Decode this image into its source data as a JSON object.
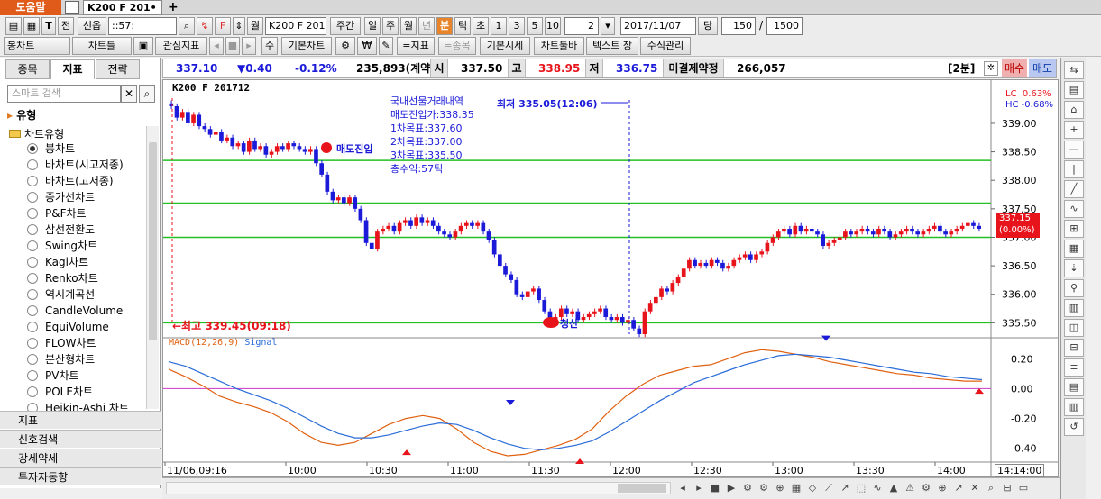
{
  "titlebar": {
    "help_label": "도움말",
    "tab_label": "K200 F 201•",
    "add_tab": "+"
  },
  "toolbar1": {
    "t_btn": "T",
    "front_btn": "전",
    "select_label": "선옵",
    "code_value": "::57:",
    "symbol_value": "K200 F 201",
    "period_btns": [
      "주간",
      "일",
      "주",
      "월",
      "년",
      "분",
      "틱",
      "초"
    ],
    "active_period": "분",
    "num_btns": [
      "1",
      "3",
      "5",
      "10"
    ],
    "interval_value": "2",
    "date_value": "2017/11/07",
    "dang": "당",
    "count_value": "150",
    "slash": "/",
    "total_value": "1500",
    "wol": "월"
  },
  "toolbar2": {
    "bong_chart": "봉차트",
    "chart_list": "차트틀",
    "watch_indicator": "관심지표",
    "su": "수",
    "basic_chart": "기본차트",
    "indicator": "=지표",
    "item": "=종목",
    "basic_price": "기본시세",
    "chart_toolbar": "차트툴바",
    "text_window": "텍스트 창",
    "formula_mgmt": "수식관리"
  },
  "leftpanel": {
    "tabs": [
      "종목",
      "지표",
      "전략"
    ],
    "active_tab": "지표",
    "search_placeholder": "스마트 검색",
    "root_label": "유형",
    "folder_label": "차트유형",
    "items": [
      "봉차트",
      "바차트(시고저종)",
      "바차트(고저종)",
      "종가선차트",
      "P&F차트",
      "삼선전환도",
      "Swing차트",
      "Kagi차트",
      "Renko차트",
      "역시계곡선",
      "CandleVolume",
      "EquiVolume",
      "FLOW차트",
      "분산형차트",
      "PV차트",
      "POLE차트",
      "Heikin-Ashi 차트"
    ],
    "selected_item": "봉차트",
    "sections": [
      "지표",
      "신호검색",
      "강세약세",
      "투자자동향"
    ]
  },
  "infobar": {
    "price": "337.10",
    "change": "▼0.40",
    "change_pct": "-0.12%",
    "volume": "235,893(계약)",
    "open_label": "시",
    "open": "337.50",
    "high_label": "고",
    "high": "338.95",
    "low_label": "저",
    "low": "336.75",
    "oi_label": "미결제약정",
    "oi": "266,057",
    "interval": "[2분]",
    "sell_label": "매수",
    "buy_label": "매도"
  },
  "chart": {
    "symbol_label": "K200 F 201712",
    "legend_lc": "LC  0.63%",
    "legend_hc": "HC -0.68%",
    "trade_info": [
      "국내선물거래내역",
      "매도진입가:338.35",
      "1차목표:337.60",
      "2차목표:337.00",
      "3차목표:335.50",
      "총수익:57틱"
    ],
    "low_annot": "최저 335.05(12:06)",
    "high_annot": "←최고 339.45(09:18)",
    "entry_label": "매도진입",
    "exit_label": "청산",
    "current_tag": "337.15",
    "current_tag_pct": "(0.00%)",
    "macd_label": "MACD(12,26,9)",
    "signal_label": "Signal",
    "bottom_time": "14:14:00",
    "colors": {
      "up": "#e8141c",
      "down": "#1a1ad8",
      "target_line": "#22c022",
      "macd": "#e06010",
      "signal": "#2a6cd8",
      "zero": "#c838c8"
    }
  },
  "chart_data": [
    {
      "type": "candlestick",
      "title": "K200 F 201712",
      "x_ticks": [
        "11/06,09:16",
        "10:00",
        "10:30",
        "11:00",
        "11:30",
        "12:00",
        "12:30",
        "13:00",
        "13:30",
        "14:00"
      ],
      "y_ticks": [
        "339.00",
        "338.50",
        "338.00",
        "337.50",
        "337.00",
        "336.50",
        "336.00",
        "335.50"
      ],
      "ylim": [
        335.3,
        339.6
      ],
      "horizontal_lines": [
        338.35,
        337.6,
        337.0,
        335.5
      ],
      "closes": [
        339.3,
        339.1,
        339.2,
        339.0,
        339.15,
        338.95,
        338.9,
        338.8,
        338.85,
        338.7,
        338.75,
        338.6,
        338.65,
        338.5,
        338.7,
        338.55,
        338.6,
        338.45,
        338.5,
        338.6,
        338.55,
        338.65,
        338.6,
        338.55,
        338.5,
        338.55,
        338.3,
        338.1,
        337.8,
        337.65,
        337.7,
        337.6,
        337.7,
        337.5,
        337.3,
        336.9,
        336.8,
        337.1,
        337.15,
        337.2,
        337.1,
        337.25,
        337.3,
        337.2,
        337.35,
        337.25,
        337.3,
        337.2,
        337.1,
        337.05,
        337.0,
        337.1,
        337.2,
        337.25,
        337.2,
        337.25,
        337.1,
        336.95,
        336.7,
        336.5,
        336.35,
        336.25,
        336.0,
        335.95,
        336.05,
        336.1,
        335.9,
        335.7,
        335.55,
        335.6,
        335.75,
        335.65,
        335.7,
        335.55,
        335.6,
        335.65,
        335.7,
        335.75,
        335.6,
        335.55,
        335.6,
        335.5,
        335.55,
        335.4,
        335.3,
        335.7,
        335.85,
        335.95,
        336.1,
        336.05,
        336.2,
        336.3,
        336.45,
        336.6,
        336.5,
        336.55,
        336.5,
        336.6,
        336.55,
        336.45,
        336.5,
        336.6,
        336.65,
        336.7,
        336.6,
        336.7,
        336.75,
        336.9,
        337.0,
        337.1,
        337.15,
        337.05,
        337.2,
        337.1,
        337.15,
        337.1,
        337.05,
        336.85,
        336.9,
        336.95,
        337.0,
        337.1,
        337.05,
        337.1,
        337.15,
        337.1,
        337.05,
        337.15,
        337.1,
        337.0,
        337.05,
        337.1,
        337.15,
        337.1,
        337.05,
        337.1,
        337.15,
        337.2,
        337.1,
        337.05,
        337.1,
        337.15,
        337.2,
        337.25,
        337.2,
        337.15
      ],
      "series": [
        {
          "name": "K200 F 201712"
        }
      ]
    },
    {
      "type": "line",
      "title": "MACD(12,26,9)",
      "y_ticks": [
        "0.20",
        "0.00",
        "-0.20",
        "-0.40"
      ],
      "ylim": [
        -0.48,
        0.28
      ],
      "series": [
        {
          "name": "MACD",
          "values": [
            0.13,
            0.08,
            0.02,
            -0.05,
            -0.09,
            -0.12,
            -0.16,
            -0.22,
            -0.3,
            -0.36,
            -0.38,
            -0.36,
            -0.3,
            -0.24,
            -0.2,
            -0.18,
            -0.2,
            -0.27,
            -0.36,
            -0.42,
            -0.45,
            -0.44,
            -0.41,
            -0.38,
            -0.34,
            -0.27,
            -0.15,
            -0.05,
            0.03,
            0.09,
            0.12,
            0.15,
            0.16,
            0.2,
            0.24,
            0.26,
            0.25,
            0.23,
            0.21,
            0.18,
            0.16,
            0.14,
            0.12,
            0.1,
            0.09,
            0.07,
            0.06,
            0.05,
            0.05
          ]
        },
        {
          "name": "Signal",
          "values": [
            0.18,
            0.15,
            0.1,
            0.05,
            0.0,
            -0.04,
            -0.08,
            -0.13,
            -0.19,
            -0.25,
            -0.3,
            -0.33,
            -0.33,
            -0.31,
            -0.28,
            -0.25,
            -0.23,
            -0.24,
            -0.28,
            -0.33,
            -0.37,
            -0.4,
            -0.41,
            -0.4,
            -0.38,
            -0.35,
            -0.29,
            -0.22,
            -0.15,
            -0.08,
            -0.02,
            0.04,
            0.08,
            0.12,
            0.16,
            0.19,
            0.22,
            0.23,
            0.22,
            0.21,
            0.19,
            0.17,
            0.15,
            0.13,
            0.11,
            0.1,
            0.08,
            0.07,
            0.06
          ]
        }
      ]
    }
  ]
}
